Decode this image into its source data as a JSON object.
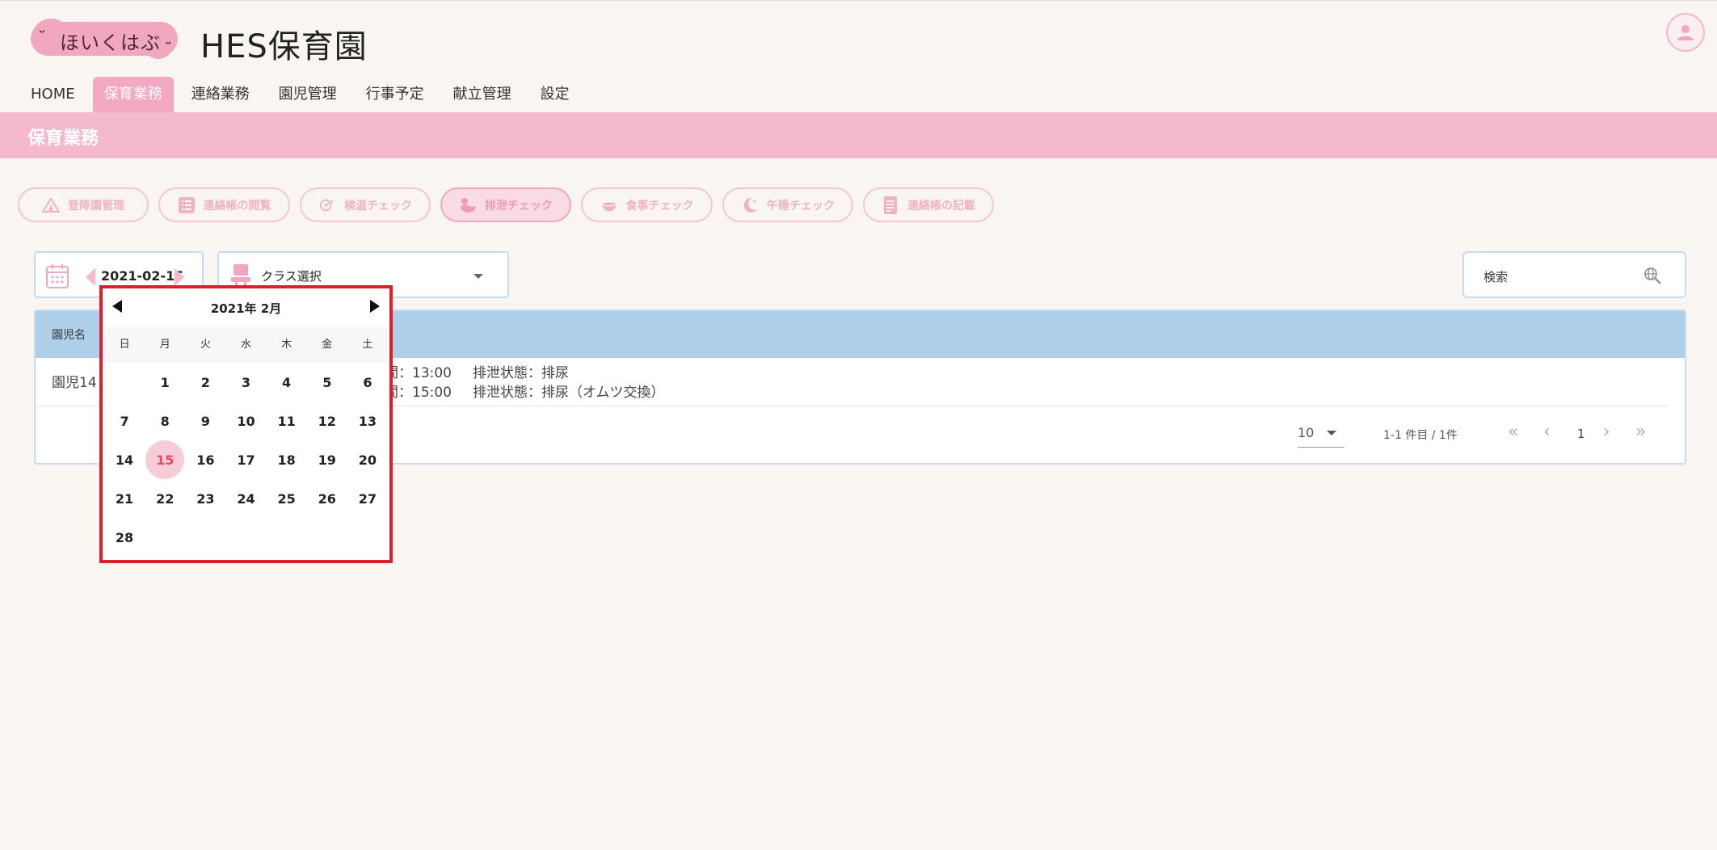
{
  "header": {
    "logo_text": "ほいくはぶ",
    "site_title": "HES保育園"
  },
  "nav": {
    "items": [
      {
        "label": "HOME",
        "active": false
      },
      {
        "label": "保育業務",
        "active": true
      },
      {
        "label": "連絡業務",
        "active": false
      },
      {
        "label": "園児管理",
        "active": false
      },
      {
        "label": "行事予定",
        "active": false
      },
      {
        "label": "献立管理",
        "active": false
      },
      {
        "label": "設定",
        "active": false
      }
    ]
  },
  "section": {
    "title": "保育業務"
  },
  "actions": [
    {
      "label": "登降園管理",
      "icon": "tent-icon",
      "active": false
    },
    {
      "label": "連絡帳の閲覧",
      "icon": "list-icon",
      "active": false
    },
    {
      "label": "検温チェック",
      "icon": "thermometer-icon",
      "active": false
    },
    {
      "label": "排泄チェック",
      "icon": "duck-icon",
      "active": true
    },
    {
      "label": "食事チェック",
      "icon": "bowl-icon",
      "active": false
    },
    {
      "label": "午睡チェック",
      "icon": "moon-icon",
      "active": false
    },
    {
      "label": "連絡帳の記載",
      "icon": "notebook-icon",
      "active": false
    }
  ],
  "filters": {
    "date": "2021-02-15",
    "class_placeholder": "クラス選択",
    "search_placeholder": "検索"
  },
  "table": {
    "header_name": "園児名",
    "rows": [
      {
        "name": "園児14",
        "line1_time": "間：13:00",
        "line1_status": "排泄状態：排尿",
        "line2_time": "間：15:00",
        "line2_status": "排泄状態：排尿（オムツ交換）"
      }
    ],
    "per_page": "10",
    "range": "1-1 件目 / 1件",
    "current_page": "1"
  },
  "datepicker": {
    "title": "2021年 2月",
    "weekdays": [
      "日",
      "月",
      "火",
      "水",
      "木",
      "金",
      "土"
    ],
    "leading_blanks": 1,
    "days": [
      "1",
      "2",
      "3",
      "4",
      "5",
      "6",
      "7",
      "8",
      "9",
      "10",
      "11",
      "12",
      "13",
      "14",
      "15",
      "16",
      "17",
      "18",
      "19",
      "20",
      "21",
      "22",
      "23",
      "24",
      "25",
      "26",
      "27",
      "28"
    ],
    "selected": "15"
  },
  "colors": {
    "accent_pink": "#f3a9c2",
    "section_bar": "#f5b9cd",
    "table_header": "#aecfea",
    "picker_border": "#dc1f2a",
    "selected_day_text": "#e8465f"
  }
}
